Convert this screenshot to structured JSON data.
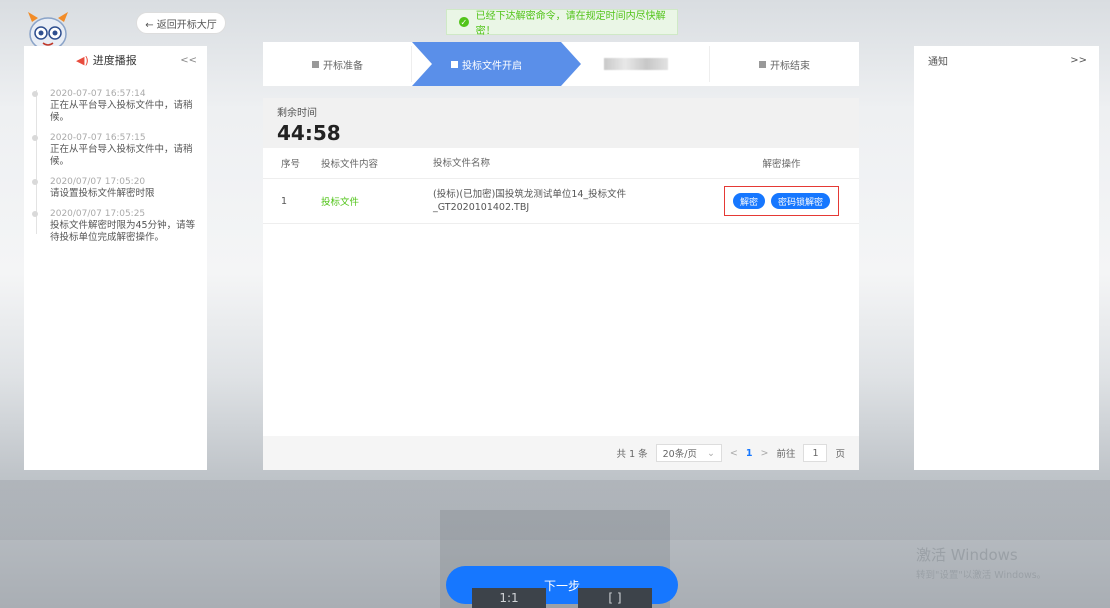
{
  "toast": {
    "text": "已经下达解密命令，请在规定时间内尽快解密！"
  },
  "back_button": {
    "label": "← 返回开标大厅"
  },
  "left_panel": {
    "title": "进度播报",
    "collapse_label": "<<",
    "timeline": [
      {
        "time": "2020-07-07 16:57:14",
        "text": "正在从平台导入投标文件中，请稍候。"
      },
      {
        "time": "2020-07-07 16:57:15",
        "text": "正在从平台导入投标文件中，请稍候。"
      },
      {
        "time": "2020/07/07 17:05:20",
        "text": "请设置投标文件解密时限"
      },
      {
        "time": "2020/07/07 17:05:25",
        "text": "投标文件解密时限为45分钟，请等待投标单位完成解密操作。"
      }
    ]
  },
  "right_panel": {
    "title": "通知",
    "expand_label": ">>"
  },
  "steps": [
    {
      "label": "开标准备",
      "active": false
    },
    {
      "label": "投标文件开启",
      "active": true
    },
    {
      "label": "",
      "active": false,
      "blurred": true
    },
    {
      "label": "开标结束",
      "active": false
    }
  ],
  "timer": {
    "label": "剩余时间",
    "value": "44:58"
  },
  "table": {
    "headers": [
      "序号",
      "投标文件内容",
      "投标文件名称",
      "解密操作"
    ],
    "rows": [
      {
        "no": "1",
        "type": "投标文件",
        "name": "(投标)(已加密)国投筑龙测试单位14_投标文件_GT2020101402.TBJ",
        "actions": [
          "解密",
          "密码锁解密"
        ]
      }
    ]
  },
  "pager": {
    "total": "共 1 条",
    "page_size": "20条/页",
    "prev": "<",
    "current": "1",
    "next": ">",
    "goto_prefix": "前往",
    "goto_value": "1",
    "goto_suffix": "页"
  },
  "next_button": {
    "label": "下一步"
  },
  "bottom_controls": [
    "1:1",
    "[ ]"
  ],
  "windows_watermark": {
    "line1": "激活 Windows",
    "line2": "转到\"设置\"以激活 Windows。"
  },
  "colors": {
    "primary": "#1677ff",
    "step_active": "#5a8fe9",
    "success": "#52c41a",
    "highlight_border": "#e53935"
  }
}
